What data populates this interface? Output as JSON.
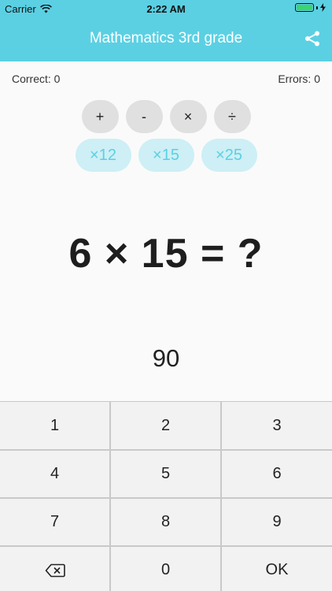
{
  "status": {
    "carrier": "Carrier",
    "time": "2:22 AM"
  },
  "header": {
    "title": "Mathematics 3rd grade"
  },
  "score": {
    "correct": "Correct: 0",
    "errors": "Errors: 0"
  },
  "operations": [
    "+",
    "-",
    "×",
    "÷"
  ],
  "multipliers": [
    "×12",
    "×15",
    "×25"
  ],
  "question": "6 × 15 = ?",
  "answer": "90",
  "keypad": [
    "1",
    "2",
    "3",
    "4",
    "5",
    "6",
    "7",
    "8",
    "9",
    "",
    "0",
    "OK"
  ],
  "colors": {
    "accent": "#5bd0e3",
    "accent_light": "#cdeff5",
    "battery": "#3bd46b"
  },
  "icons": {
    "share": "share-icon",
    "backspace": "backspace-icon",
    "wifi": "wifi-icon",
    "charging": "charging-icon"
  }
}
